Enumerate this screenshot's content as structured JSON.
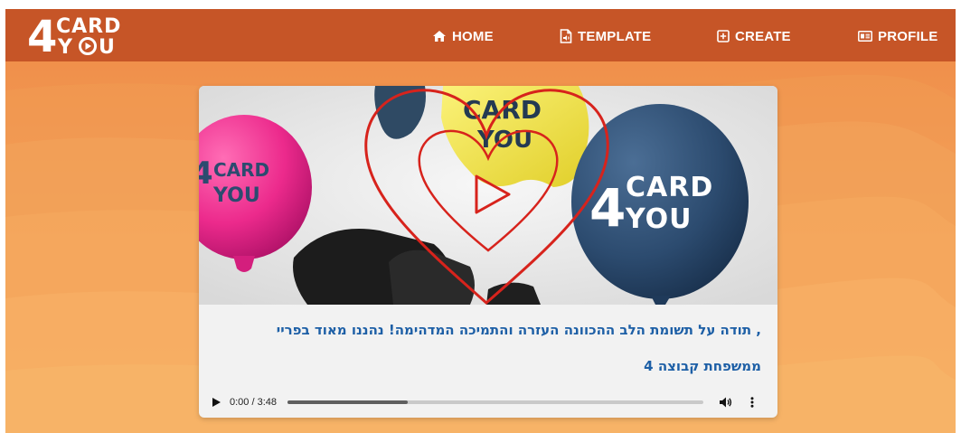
{
  "brand": {
    "logo_digit": "4",
    "logo_top": "CARD",
    "logo_bottom_left": "Y",
    "logo_bottom_right": "U",
    "bar_color": "#c65527"
  },
  "nav": {
    "items": [
      {
        "label": "HOME",
        "icon": "home-icon"
      },
      {
        "label": "TEMPLATE",
        "icon": "template-icon"
      },
      {
        "label": "CREATE",
        "icon": "create-plus-icon"
      },
      {
        "label": "PROFILE",
        "icon": "profile-card-icon"
      }
    ]
  },
  "card": {
    "image": {
      "description_icon": "play-icon",
      "balloon_left_text_top": "CARD",
      "balloon_left_digit": "4",
      "balloon_left_text_bottom": "YOU",
      "balloon_right_digit": "4",
      "balloon_right_text_top": "CARD",
      "balloon_right_text_bottom": "YOU",
      "balloon_top_text": "CARD",
      "balloon_top_text_bottom": "YOU"
    },
    "caption_line1": ", תודה על תשומת הלב ההכוונה העזרה והתמיכה המדהימה! נהננו מאוד בפריי",
    "caption_line2": "ממשפחת קבוצה 4",
    "text_color": "#1d5fa6"
  },
  "audio": {
    "time": "0:00 / 3:48",
    "progress_fraction": 0.29
  }
}
